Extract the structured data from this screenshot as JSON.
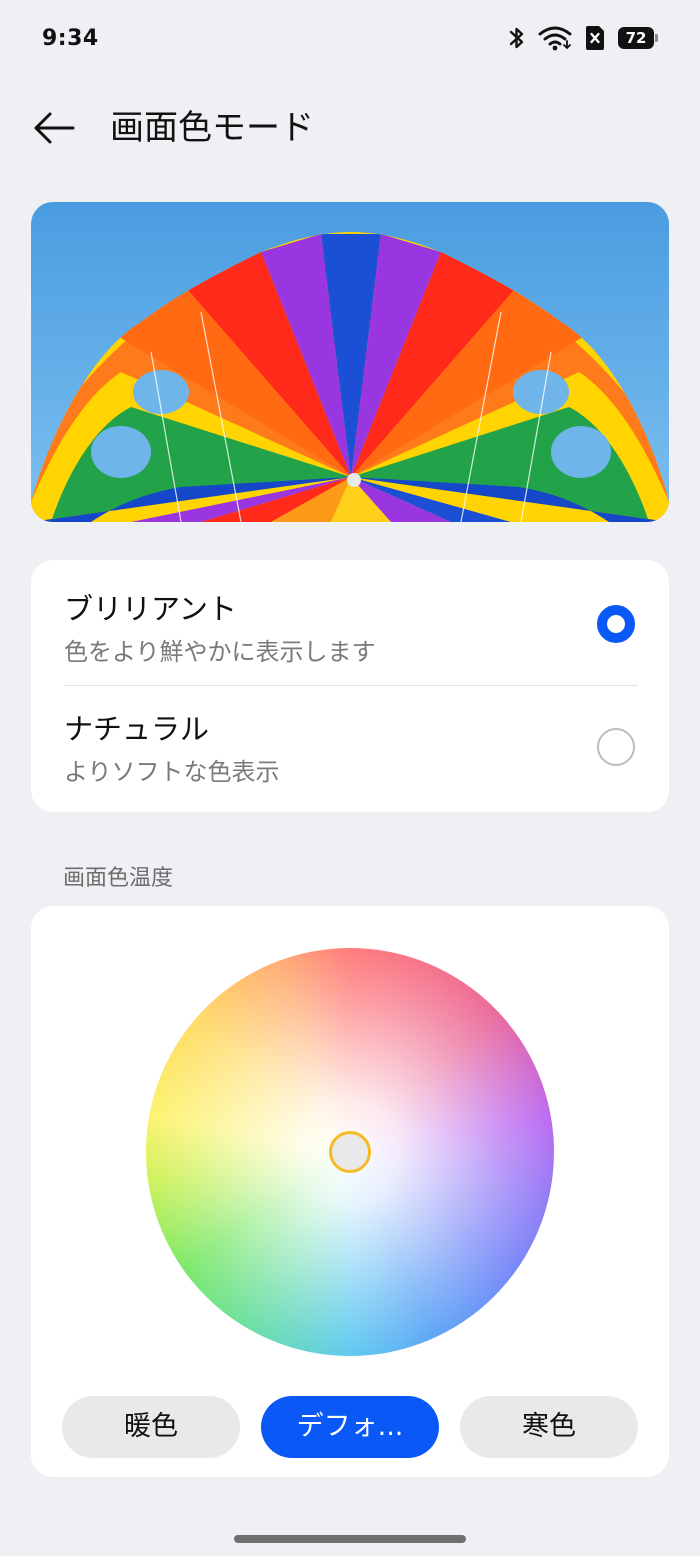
{
  "status_bar": {
    "time": "9:34",
    "battery_level": "72",
    "icons": [
      "bluetooth-icon",
      "wifi-icon",
      "sim-card-icon",
      "battery-icon"
    ]
  },
  "header": {
    "back_icon": "arrow-left-icon",
    "title": "画面色モード"
  },
  "preview": {
    "description_icon": "rainbow-parachute-image"
  },
  "modes": [
    {
      "title": "ブリリアント",
      "subtitle": "色をより鮮やかに表示します",
      "selected": true
    },
    {
      "title": "ナチュラル",
      "subtitle": "よりソフトな色表示",
      "selected": false
    }
  ],
  "temperature": {
    "section_label": "画面色温度",
    "presets": [
      {
        "label": "暖色",
        "selected": false
      },
      {
        "label": "デフォ...",
        "selected": true
      },
      {
        "label": "寒色",
        "selected": false
      }
    ]
  },
  "colors": {
    "accent": "#0a59f7",
    "background": "#eef0f3",
    "card": "#ffffff",
    "thumb_ring": "#f4bb23"
  }
}
